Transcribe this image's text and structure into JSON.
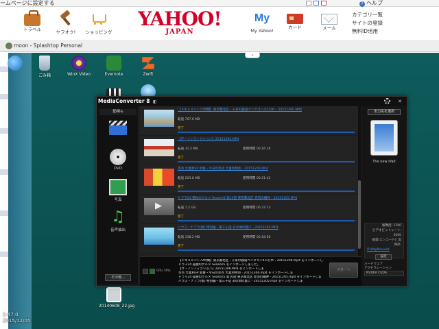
{
  "browser": {
    "set_home": "ームページに設定する",
    "help": "ヘルプ"
  },
  "yahoo": {
    "logo_main": "YAHOO!",
    "logo_sub": "JAPAN",
    "services": [
      {
        "label": "トラベル",
        "icon": "suitcase-icon"
      },
      {
        "label": "ヤフオク!",
        "icon": "auction-hammer-icon"
      },
      {
        "label": "ショッピング",
        "icon": "shopping-cart-icon"
      },
      {
        "label": "My Yahoo!",
        "icon": "my-yahoo-icon"
      },
      {
        "label": "カード",
        "icon": "credit-card-icon"
      },
      {
        "label": "メール",
        "icon": "mail-icon"
      }
    ],
    "links": [
      "カテゴリ一覧",
      "サイトの登録",
      "無料ID活用"
    ]
  },
  "splashtop": {
    "title": "moon - Splashtop Personal",
    "toggle": "⌄"
  },
  "desktop": {
    "icons": [
      {
        "label": "",
        "icon": "windows-orb-icon"
      },
      {
        "label": "ごみ箱",
        "icon": "recycle-bin-icon"
      },
      {
        "label": "WinX Video",
        "icon": "winx-video-icon"
      },
      {
        "label": "Evernote",
        "icon": "evernote-icon"
      },
      {
        "label": "Zwift",
        "icon": "zwift-icon"
      },
      {
        "label": "",
        "icon": "media-converter-icon"
      },
      {
        "label": "",
        "icon": "blue-app-icon"
      },
      {
        "label": "20140608_22.jpg",
        "icon": "photo-file-icon"
      }
    ],
    "clock": [
      "1:47:0",
      "2015/12/05"
    ]
  },
  "mediaconverter": {
    "title": "MediaConverter 8",
    "badge": "◧",
    "win_buttons": "— ✕",
    "nav_header": "動画&",
    "nav": [
      {
        "label": "ビデオ",
        "icon": "video-clapper-icon"
      },
      {
        "label": "DVD",
        "icon": "dvd-disc-icon"
      },
      {
        "label": "写真",
        "icon": "photo-icon"
      },
      {
        "label": "音声抽出",
        "icon": "music-note-icon"
      }
    ],
    "nav_bottom": "その他...",
    "rows": [
      {
        "name": "【ドキュメント72時間】東京都北区・十条の銭湯ペンタゴン4人びれ - 2015120E.MP4",
        "size": "転送  767.6 MB",
        "time": "",
        "status": "完了"
      },
      {
        "name": "【ザ・ノンフィクション】20151206.MP4",
        "size": "転送  31.2 MB",
        "time": "使用時間  00:16:18",
        "status": "完了"
      },
      {
        "name": "笑点 大喜利SP 新春・今日の笑点 大喜利特別 - 20151206.MP4",
        "size": "転送  203.8 MB",
        "time": "使用時間  00:21:42",
        "status": "完了"
      },
      {
        "name": "ドラマ24 孤独のグルメ Season5 第10話 東京都北区 赤羽の鰻丼 - 20151205.MP4",
        "size": "転送  1.2 GB",
        "time": "使用時間  00:37:13",
        "status": "完了"
      },
      {
        "name": "ハウス・ナブラ(仮) 特別編・第三十話 あの頃の夏に - 20151205.MP4",
        "size": "転送  338.2 MB",
        "time": "使用時間  00:18:06",
        "status": "完了"
      }
    ],
    "output": {
      "button": "出力先を選択",
      "device": "The new iPad",
      "settings": [
        "解像度: 1280",
        "ビデオビットレート: 3000",
        "画質(エンコード): 高",
        "保存:"
      ],
      "folder_link": "D:¥MyMovies¥",
      "set_button": "設定",
      "hw_label_1": "ハードウェア",
      "hw_label_2": "アクセラレーション",
      "gpu": "NVIDIA CUDA"
    },
    "log": {
      "cpu": "CPU 70%",
      "lines": [
        "【ドキュメント72時間】東京都北区・十条の銭湯ペンタゴン4人びれ - 20151206.mp4 をインポートしま",
        "ドラマ24 孤独のグルメ Season5 をインポートしました。",
        "【ザ・ノンフィクション】20151206.MP4 をインポートしま",
        "笑点 大喜利SP 新春・今日の笑点 大喜利特別 - 20151206.mp4 をインポートしま",
        "ドラマ24 孤独のグルメ Season5 第10話 東京都北区 赤羽の鰻丼 - 20151205.mp4 をインポートしま",
        "ハウス・ナブラ(仮) 特別編・第三十話 あの頃の夏に - 20151205.mp4 をインポートしま"
      ],
      "convert_button": "スタート"
    }
  }
}
